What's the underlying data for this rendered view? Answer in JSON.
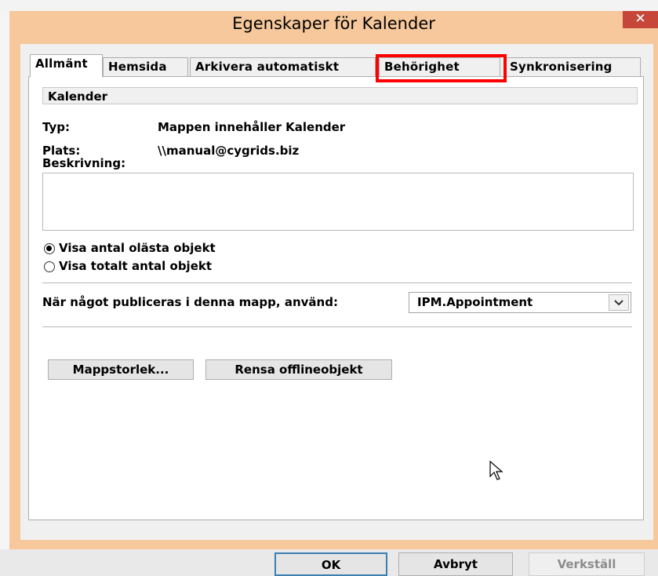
{
  "window": {
    "title": "Egenskaper för Kalender",
    "close_glyph": "✕"
  },
  "tabs": [
    {
      "label": "Allmänt",
      "active": true
    },
    {
      "label": "Hemsida",
      "active": false
    },
    {
      "label": "Arkivera automatiskt",
      "active": false
    },
    {
      "label": "Behörighet",
      "active": false,
      "highlighted": true
    },
    {
      "label": "Synkronisering",
      "active": false
    }
  ],
  "general": {
    "folder_name": "Kalender",
    "type_label": "Typ:",
    "type_value": "Mappen innehåller Kalender",
    "location_label": "Plats:",
    "location_value": "\\\\manual@cygrids.biz",
    "description_label": "Beskrivning:",
    "description_value": "",
    "radio_unread": "Visa antal olästa objekt",
    "radio_total": "Visa totalt antal objekt",
    "radio_selected": "unread",
    "post_form_label": "När något publiceras i denna mapp, använd:",
    "post_form_value": "IPM.Appointment",
    "folder_size_button": "Mappstorlek...",
    "clear_offline_button": "Rensa offlineobjekt"
  },
  "footer": {
    "ok": "OK",
    "cancel": "Avbryt",
    "apply": "Verkställ"
  },
  "colors": {
    "frame": "#f6c89b",
    "close": "#c7463a",
    "highlight": "#ff0000"
  }
}
